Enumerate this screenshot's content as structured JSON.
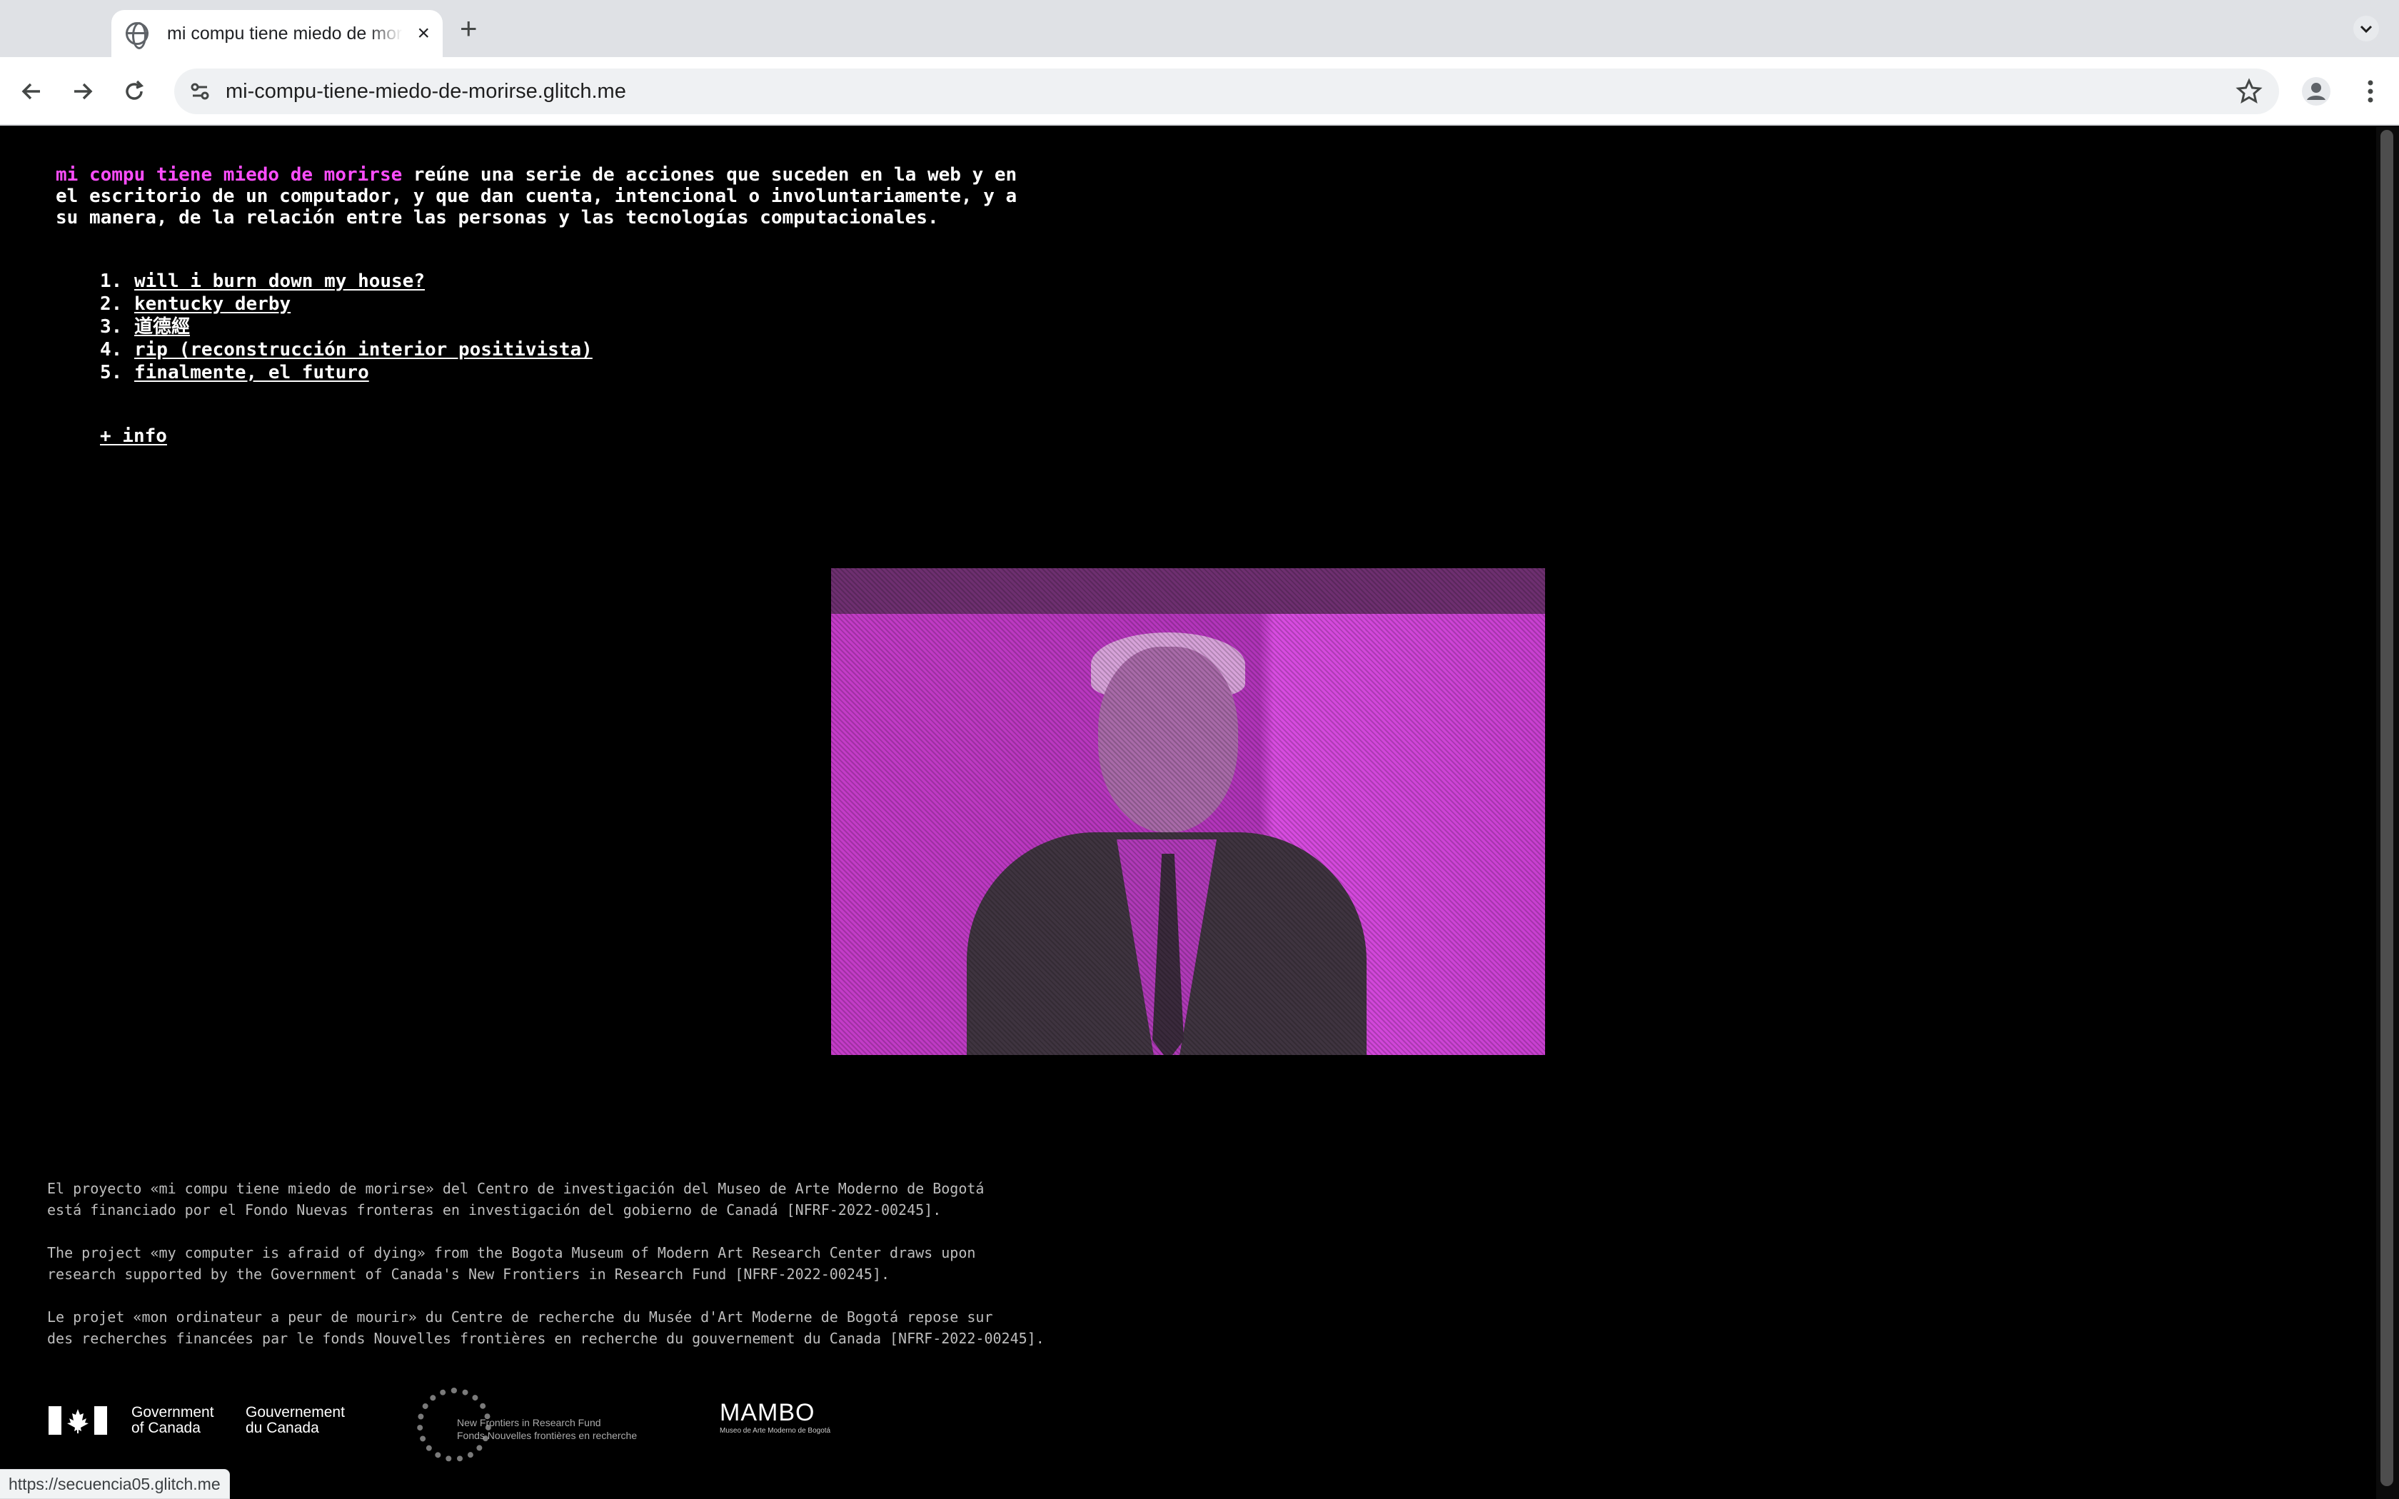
{
  "browser": {
    "tab_title": "mi compu tiene miedo de morirse",
    "tab_close": "×",
    "new_tab": "+",
    "url": "mi-compu-tiene-miedo-de-morirse.glitch.me",
    "status_url": "https://secuencia05.glitch.me"
  },
  "intro": {
    "highlight": "mi compu tiene miedo de morirse",
    "text": " reúne una serie de acciones que suceden en la web y en el escritorio de un computador, y que dan cuenta, intencional o involuntariamente, y a su manera, de la relación entre las personas y las tecnologías computacionales."
  },
  "works": [
    {
      "num": "1.",
      "label": "will i burn down my house?"
    },
    {
      "num": "2.",
      "label": "kentucky derby"
    },
    {
      "num": "3.",
      "label": "道德經"
    },
    {
      "num": "4.",
      "label": "rip (reconstrucción interior positivista)"
    },
    {
      "num": "5.",
      "label": "finalmente, el futuro"
    }
  ],
  "more_info": "+ info",
  "funding": {
    "es": "El proyecto «mi compu tiene miedo de morirse» del Centro de investigación del Museo de Arte Moderno de Bogotá\nestá financiado por el Fondo Nuevas fronteras en investigación del gobierno de Canadá [NFRF-2022-00245].",
    "en": "The project «my computer is afraid of dying» from the Bogota Museum of Modern Art Research Center draws upon\nresearch supported by the Government of Canada's New Frontiers in Research Fund [NFRF-2022-00245].",
    "fr": "Le projet «mon ordinateur a peur de mourir» du Centre de recherche du Musée d'Art Moderne de Bogotá repose sur\ndes recherches financées par le fonds Nouvelles frontières en recherche du gouvernement du Canada [NFRF-2022-00245]."
  },
  "logos": {
    "canada_en": "Government\nof Canada",
    "canada_fr": "Gouvernement\ndu Canada",
    "nfrf": "New Frontiers in Research Fund\nFonds Nouvelles frontières en recherche",
    "mambo": "MAMBO",
    "mambo_sub": "Museo de Arte Moderno de Bogotá"
  },
  "colors": {
    "highlight": "#ff4dff",
    "background": "#000000"
  }
}
